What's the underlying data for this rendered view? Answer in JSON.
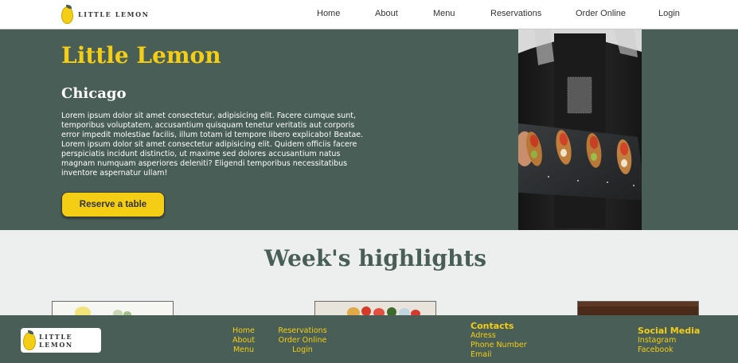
{
  "nav": {
    "brand": "LITTLE LEMON",
    "links": [
      "Home",
      "About",
      "Menu",
      "Reservations",
      "Order Online",
      "Login"
    ]
  },
  "hero": {
    "title": "Little Lemon",
    "subtitle": "Chicago",
    "description": "Lorem ipsum dolor sit amet consectetur, adipisicing elit. Facere cumque sunt, temporibus voluptatem, accusantium quisquam tenetur veritatis aut corporis error impedit molestiae facilis, illum totam id tempore libero explicabo! Beatae. Lorem ipsum dolor sit amet consectetur adipisicing elit. Quidem officiis facere perspiciatis incidunt distinctio, ut maxime sed dolores accusantium natus magnam numquam asperiores deleniti? Eligendi temporibus necessitatibus inventore aspernatur ullam!",
    "button": "Reserve a table"
  },
  "highlights": {
    "title": "Week's highlights"
  },
  "footer": {
    "brand": "LITTLE LEMON",
    "nav_col1": [
      "Home",
      "About",
      "Menu"
    ],
    "nav_col2": [
      "Reservations",
      "Order Online",
      "Login"
    ],
    "contacts_title": "Contacts",
    "contacts": [
      "Adress",
      "Phone Number",
      "Email"
    ],
    "social_title": "Social Media",
    "social": [
      "Instagram",
      "Facebook"
    ]
  },
  "colors": {
    "primary_green": "#495e57",
    "primary_yellow": "#f4ce14",
    "highlight_bg": "#edefee"
  }
}
